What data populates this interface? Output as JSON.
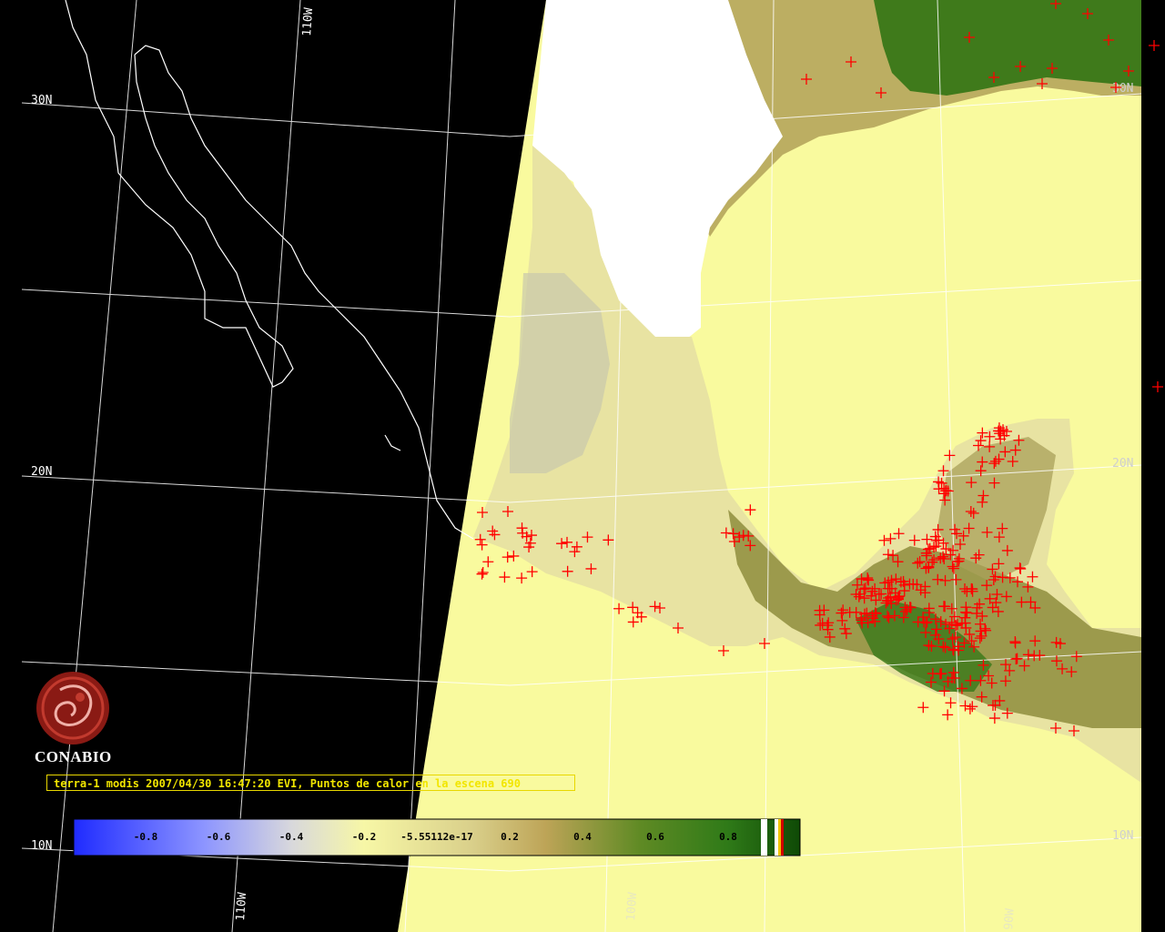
{
  "map": {
    "grid_labels": {
      "lat_30": "30N",
      "lat_20": "20N",
      "lat_10": "10N",
      "lon_110_top": "110W",
      "lon_110_bottom": "110W",
      "lon_100_bottom": "100W",
      "lon_90_bottom": "90W",
      "lat_20_right": "20N",
      "lat_30_right": "30N",
      "lat_10_right": "10N"
    },
    "colors": {
      "space": "#000000",
      "ocean": "#f9fa9e",
      "land_low": "#d8d28c",
      "vegetation": "#3d7a1e",
      "cloud": "#ffffff",
      "fire": "#ff0000",
      "grid": "#ffffff",
      "coast": "#ffffff"
    }
  },
  "branding": {
    "logo_text": "CONABIO"
  },
  "caption": {
    "text": "terra-1 modis 2007/04/30 16:47:20 EVI, Puntos de calor en la escena 690"
  },
  "colorbar": {
    "ticks": [
      "-0.8",
      "-0.6",
      "-0.4",
      "-0.2",
      "-5.55112e-17",
      "0.2",
      "0.4",
      "0.6",
      "0.8"
    ],
    "colors": [
      "#1f2bff",
      "#8d95ff",
      "#c8c9d9",
      "#f7f7a6",
      "#d9cf8a",
      "#bda457",
      "#6f8b2c",
      "#2f7a18",
      "#0f4a06"
    ]
  }
}
